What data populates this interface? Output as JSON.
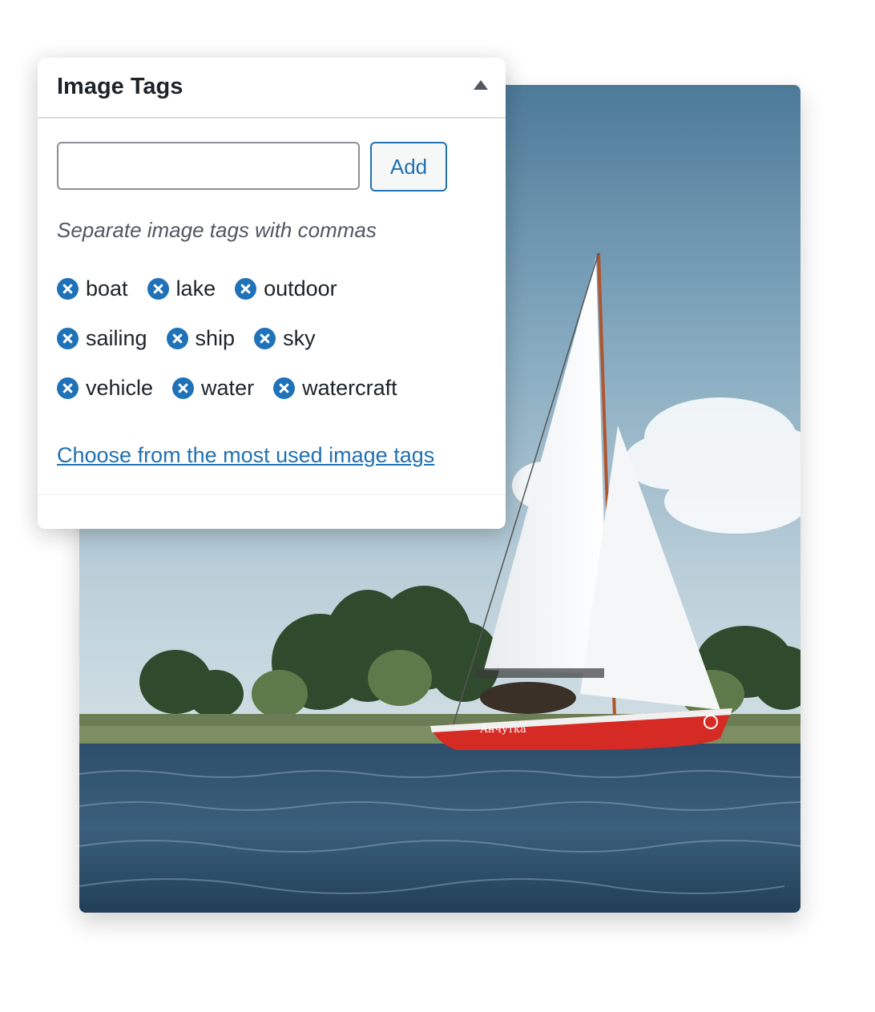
{
  "panel": {
    "title": "Image Tags",
    "toggle_icon": "triangle-up-icon",
    "input": {
      "value": "",
      "placeholder": ""
    },
    "add_label": "Add",
    "hint": "Separate image tags with commas",
    "tags": [
      [
        "boat",
        "lake",
        "outdoor"
      ],
      [
        "sailing",
        "ship",
        "sky"
      ],
      [
        "vehicle",
        "water",
        "watercraft"
      ]
    ],
    "remove_icon": "remove-circle-icon",
    "most_used_link": "Choose from the most used image tags"
  },
  "photo": {
    "hull_text": "Анчутка"
  },
  "colors": {
    "accent": "#2271b1",
    "remove_icon": "#1f72b8",
    "hull": "#d62a24"
  }
}
